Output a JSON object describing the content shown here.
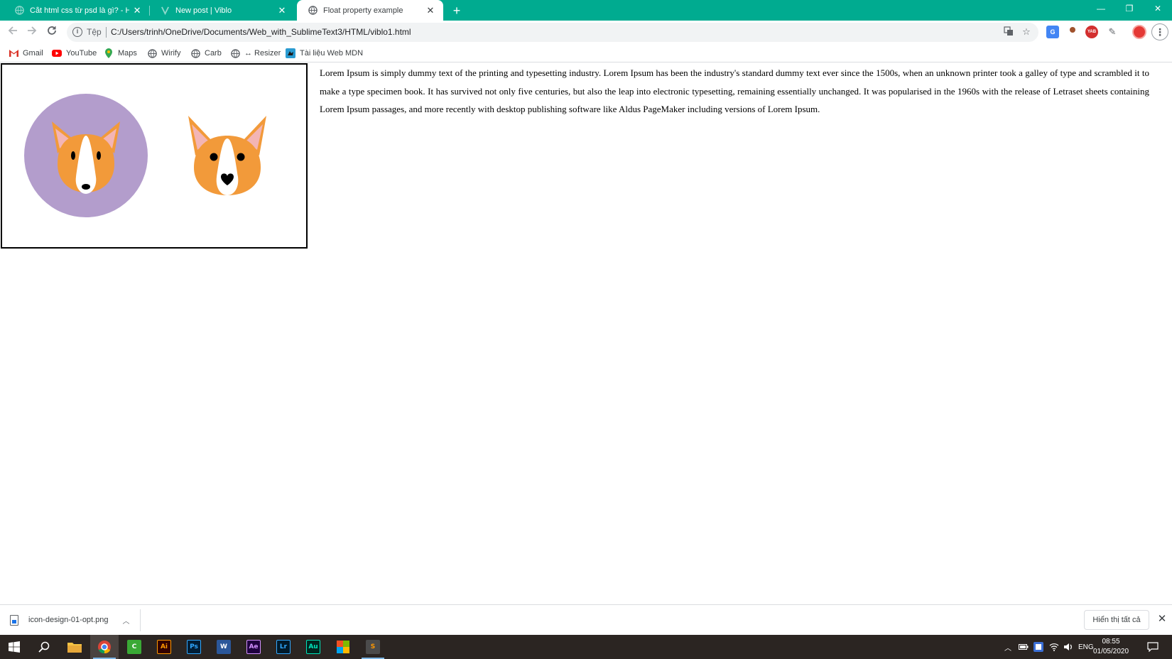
{
  "browser": {
    "tabs": [
      {
        "title": "Cắt html css từ psd là gì? - Học h",
        "state": "inactive",
        "favicon": "globe-icon"
      },
      {
        "title": "New post | Viblo",
        "state": "inactive",
        "favicon": "viblo-logo-icon"
      },
      {
        "title": "Float property example",
        "state": "active",
        "favicon": "globe-icon"
      }
    ],
    "new_tab": "+",
    "window_controls": {
      "minimize": "—",
      "restore": "❐",
      "close": "✕"
    },
    "address_bar": {
      "scheme_label": "Tệp",
      "url": "C:/Users/trinh/OneDrive/Documents/Web_with_SublimeText3/HTML/viblo1.html"
    },
    "bookmarks": [
      {
        "label": "Gmail",
        "icon": "gmail-icon"
      },
      {
        "label": "YouTube",
        "icon": "youtube-icon"
      },
      {
        "label": "Maps",
        "icon": "maps-icon"
      },
      {
        "label": "Wirify",
        "icon": "globe-icon"
      },
      {
        "label": "Carb",
        "icon": "globe-icon"
      },
      {
        "label": "↔ Resizer",
        "icon": "globe-icon"
      },
      {
        "label": "Tài liệu Web MDN",
        "icon": "mdn-icon"
      }
    ]
  },
  "page": {
    "paragraph": "Lorem Ipsum is simply dummy text of the printing and typesetting industry. Lorem Ipsum has been the industry's standard dummy text ever since the 1500s, when an unknown printer took a galley of type and scrambled it to make a type specimen book. It has survived not only five centuries, but also the leap into electronic typesetting, remaining essentially unchanged. It was popularised in the 1960s with the release of Letraset sheets containing Lorem Ipsum passages, and more recently with desktop publishing software like Aldus PageMaker including versions of Lorem Ipsum.",
    "image_colors": {
      "circle": "#b39dcc",
      "fur": "#f29a3a",
      "ear_inner": "#f3b5b5",
      "face_white": "#ffffff",
      "eyes": "#000000"
    }
  },
  "downloads": {
    "file_name": "icon-design-01-opt.png",
    "show_all": "Hiển thị tất cả"
  },
  "taskbar": {
    "apps": [
      {
        "name": "file-explorer",
        "label": ""
      },
      {
        "name": "chrome",
        "label": ""
      },
      {
        "name": "camtasia",
        "label": "C"
      },
      {
        "name": "illustrator",
        "label": "Ai"
      },
      {
        "name": "photoshop",
        "label": "Ps"
      },
      {
        "name": "word",
        "label": "W"
      },
      {
        "name": "after-effects",
        "label": "Ae"
      },
      {
        "name": "lightroom",
        "label": "Lr"
      },
      {
        "name": "audition",
        "label": "Au"
      },
      {
        "name": "office",
        "label": ""
      },
      {
        "name": "sublime-text",
        "label": "S"
      }
    ],
    "language": "ENG",
    "time": "08:55",
    "date": "01/05/2020"
  }
}
